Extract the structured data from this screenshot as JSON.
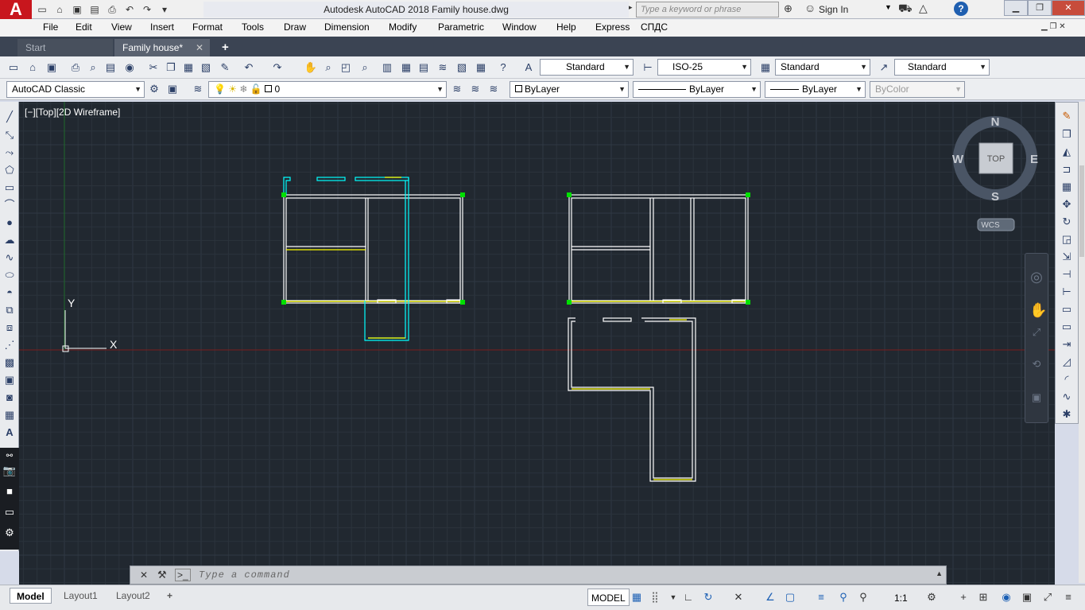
{
  "title_bar": {
    "app_logo": "A",
    "title": "Autodesk AutoCAD 2018    Family house.dwg",
    "search_placeholder": "Type a keyword or phrase",
    "sign_in": "Sign In"
  },
  "menu": {
    "items": [
      "File",
      "Edit",
      "View",
      "Insert",
      "Format",
      "Tools",
      "Draw",
      "Dimension",
      "Modify",
      "Parametric",
      "Window",
      "Help",
      "Express",
      "СПДС"
    ]
  },
  "tabs": {
    "start": "Start",
    "document": "Family house*",
    "add": "+"
  },
  "styles_toolbar": {
    "text_style": "Standard",
    "dim_style": "ISO-25",
    "table_style": "Standard",
    "mleader_style": "Standard"
  },
  "layers_toolbar": {
    "workspace": "AutoCAD Classic",
    "layer": "0",
    "color": "ByLayer",
    "linetype": "ByLayer",
    "lineweight": "ByLayer",
    "plotstyle": "ByColor"
  },
  "viewport": {
    "label": "[−][Top][2D Wireframe]",
    "ucs_x": "X",
    "ucs_y": "Y",
    "viewcube": {
      "north": "N",
      "south": "S",
      "east": "E",
      "west": "W",
      "face": "TOP",
      "wcs": "WCS"
    }
  },
  "command_line": {
    "placeholder": "Type a command"
  },
  "status_bar": {
    "layout_tabs": [
      "Model",
      "Layout1",
      "Layout2"
    ],
    "add_tab": "+",
    "model_button": "MODEL",
    "scale": "1:1"
  },
  "colors": {
    "viewport_bg": "#212830",
    "grid": "#2b333c",
    "wall_lines": "#ffffff",
    "highlight_lines": "#ffff00",
    "selection_lines": "#00ffff",
    "grips": "#00e000",
    "x_axis": "#8b1a1a",
    "y_axis": "#1f6b2b"
  }
}
